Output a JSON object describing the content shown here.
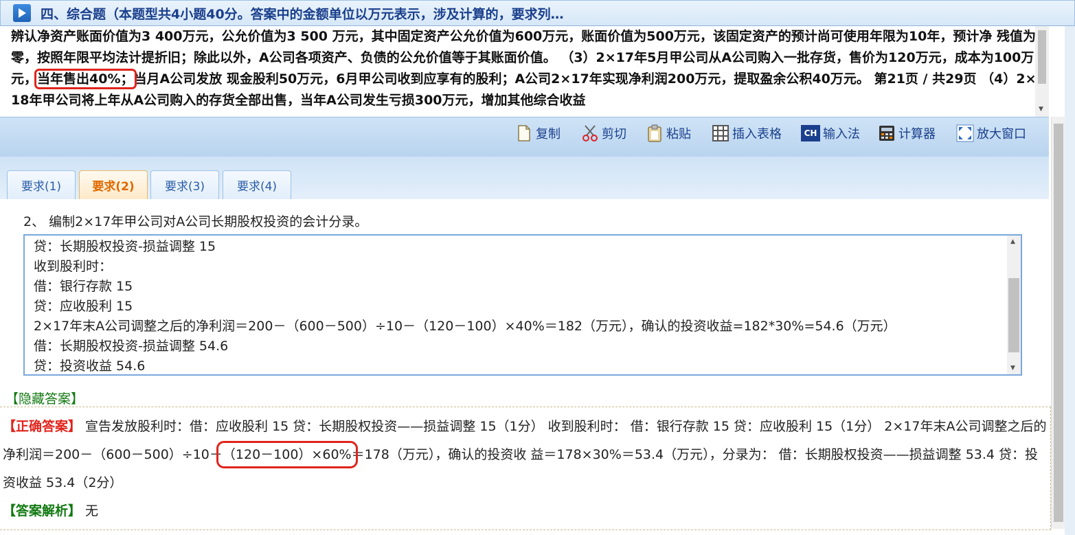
{
  "title": "四、综合题（本题型共4小题40分。答案中的金额单位以万元表示，涉及计算的，要求列…",
  "question": {
    "before_highlight": "辨认净资产账面价值为3 400万元，公允价值为3 500 万元，其中固定资产公允价值为600万元，账面价值为500万元，该固定资产的预计尚可使用年限为10年，预计净 残值为零，按照年限平均法计提折旧；除此以外，A公司各项资产、负债的公允价值等于其账面价值。 （3）2×17年5月甲公司从A公司购入一批存货，售价为120万元，成本为100万元，",
    "highlight": "当年售出40%；",
    "after_highlight": "当月A公司发放 现金股利50万元，6月甲公司收到应享有的股利；A公司2×17年实现净利润200万元，提取盈余公积40万元。 第21页 / 共29页 （4）2×18年甲公司将上年从A公司购入的存货全部出售，当年A公司发生亏损300万元，增加其他综合收益"
  },
  "toolbar": {
    "copy": "复制",
    "cut": "剪切",
    "paste": "粘贴",
    "insert_table": "插入表格",
    "ime": "输入法",
    "ime_badge": "CH",
    "calculator": "计算器",
    "maximize": "放大窗口"
  },
  "tabs": [
    "要求(1)",
    "要求(2)",
    "要求(3)",
    "要求(4)"
  ],
  "active_tab": "要求(2)",
  "requirement": "2、 编制2×17年甲公司对A公司长期股权投资的会计分录。",
  "answer_lines": [
    "贷：长期股权投资-损益调整 15",
    "收到股利时：",
    "借：银行存款 15",
    "贷：应收股利 15",
    "2×17年末A公司调整之后的净利润＝200－（600－500）÷10－（120－100）×40%＝182（万元），确认的投资收益=182*30%=54.6（万元）",
    "借：长期股权投资-损益调整 54.6",
    "贷：投资收益 54.6"
  ],
  "hide_answer": "【隐藏答案】",
  "correct": {
    "label": "【正确答案】",
    "before_highlight": " 宣告发放股利时：借：应收股利 15 贷：长期股权投资——损益调整 15（1分） 收到股利时： 借：银行存款 15 贷：应收股利 15（1分） 2×17年末A公司调整之后的净利润＝200－（600－500）÷10－",
    "highlight": "（120－100）×60%",
    "after_highlight": "＝178（万元），确认的投资收 益＝178×30%＝53.4（万元），分录为： 借：长期股权投资——损益调整 53.4 贷：投资收益 53.4（2分）"
  },
  "analysis": {
    "label": "【答案解析】",
    "text": " 无"
  },
  "colors": {
    "title": "#1a3f8c",
    "highlight_box": "#e0241c",
    "active_tab": "#e06a00",
    "green_label": "#127a12"
  }
}
